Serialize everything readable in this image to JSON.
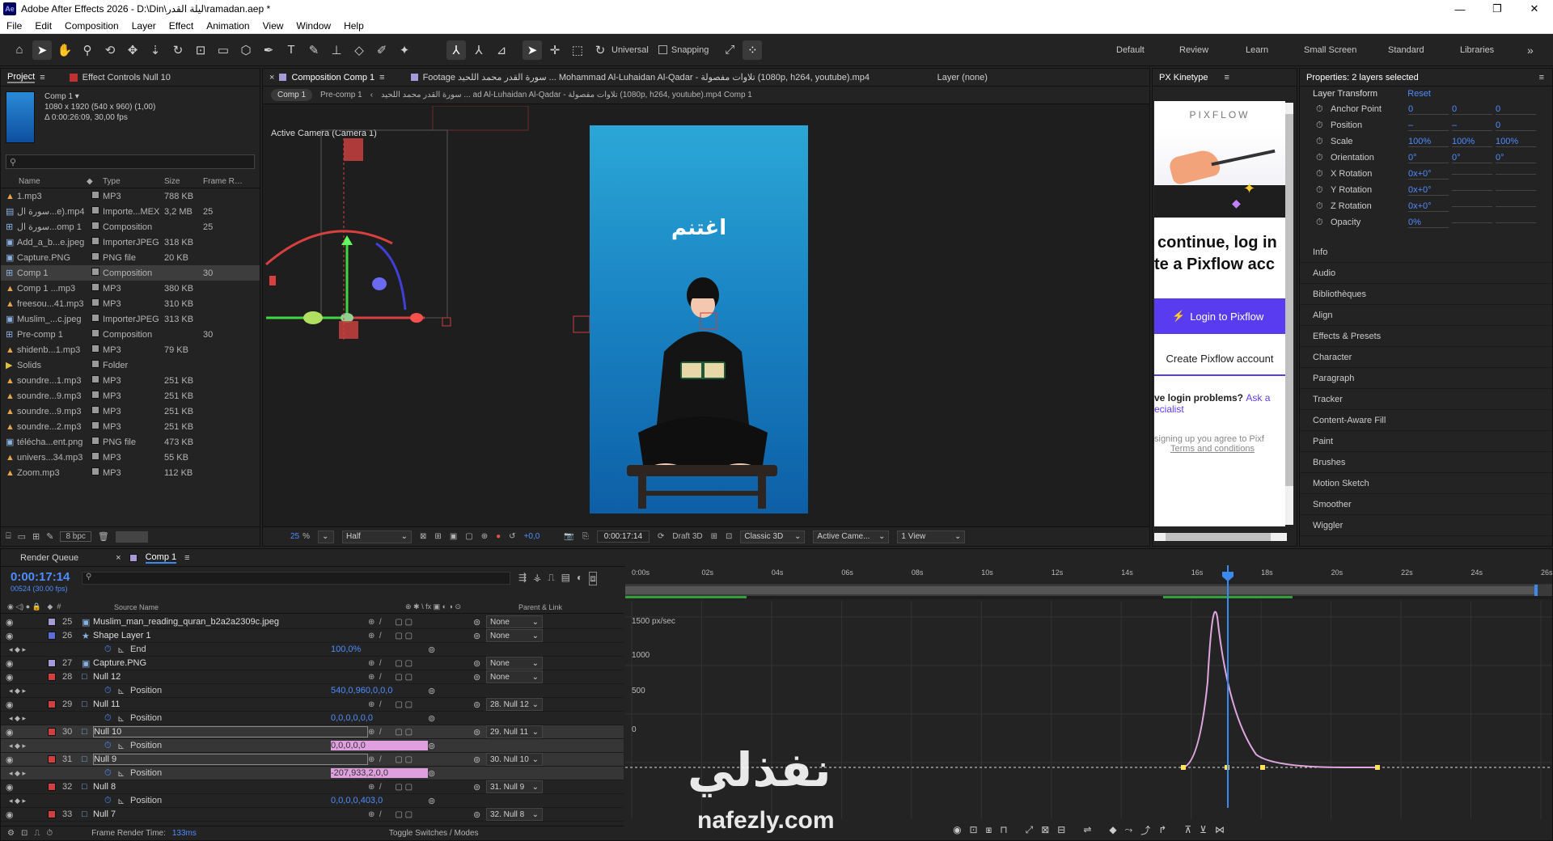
{
  "titlebar": {
    "title": "Adobe After Effects 2026 - D:\\Din\\ليلة القدر\\ramadan.aep *",
    "app_icon": "Ae",
    "minimize": "—",
    "maximize": "❐",
    "close": "✕"
  },
  "menu": [
    "File",
    "Edit",
    "Composition",
    "Layer",
    "Effect",
    "Animation",
    "View",
    "Window",
    "Help"
  ],
  "toolbar": {
    "universal": "Universal",
    "snapping": "Snapping",
    "workspaces": [
      "Default",
      "Review",
      "Learn",
      "Small Screen",
      "Standard",
      "Libraries"
    ],
    "more": "»"
  },
  "project": {
    "tab_project": "Project",
    "tab_effect": "Effect Controls Null 10",
    "comp_name": "Comp 1 ▾",
    "comp_info1": "1080 x 1920  (540 x 960) (1,00)",
    "comp_info2": "Δ 0:00:26:09, 30,00 fps",
    "search_placeholder": "",
    "headers": {
      "name": "Name",
      "type": "Type",
      "size": "Size",
      "frame": "Frame Ra..."
    },
    "items": [
      {
        "name": "1.mp3",
        "type": "MP3",
        "size": "788 KB",
        "fr": "",
        "icon": "cone",
        "color": "#c8c8c8"
      },
      {
        "name": "سورة ال...e).mp4",
        "type": "Importe...MEX",
        "size": "3,2 MB",
        "fr": "25",
        "icon": "film",
        "color": "#c8c8c8"
      },
      {
        "name": "سورة ال...omp 1",
        "type": "Composition",
        "size": "",
        "fr": "25",
        "icon": "comp",
        "color": "#c8c8c8"
      },
      {
        "name": "Add_a_b...e.jpeg",
        "type": "ImporterJPEG",
        "size": "318 KB",
        "fr": "",
        "icon": "img",
        "color": "#c8c8c8"
      },
      {
        "name": "Capture.PNG",
        "type": "PNG file",
        "size": "20 KB",
        "fr": "",
        "icon": "img",
        "color": "#c8c8c8"
      },
      {
        "name": "Comp 1",
        "type": "Composition",
        "size": "",
        "fr": "30",
        "icon": "comp",
        "color": "#c8c8c8",
        "selected": true
      },
      {
        "name": "Comp 1 ...mp3",
        "type": "MP3",
        "size": "380 KB",
        "fr": "",
        "icon": "cone",
        "color": "#c8c8c8"
      },
      {
        "name": "freesou...41.mp3",
        "type": "MP3",
        "size": "310 KB",
        "fr": "",
        "icon": "cone",
        "color": "#c8c8c8"
      },
      {
        "name": "Muslim_...c.jpeg",
        "type": "ImporterJPEG",
        "size": "313 KB",
        "fr": "",
        "icon": "img",
        "color": "#c8c8c8"
      },
      {
        "name": "Pre-comp 1",
        "type": "Composition",
        "size": "",
        "fr": "30",
        "icon": "comp",
        "color": "#c8c8c8"
      },
      {
        "name": "shidenb...1.mp3",
        "type": "MP3",
        "size": "79 KB",
        "fr": "",
        "icon": "cone",
        "color": "#c8c8c8"
      },
      {
        "name": "Solids",
        "type": "Folder",
        "size": "",
        "fr": "",
        "icon": "folder",
        "color": "#e0c040"
      },
      {
        "name": "soundre...1.mp3",
        "type": "MP3",
        "size": "251 KB",
        "fr": "",
        "icon": "cone",
        "color": "#c8c8c8"
      },
      {
        "name": "soundre...9.mp3",
        "type": "MP3",
        "size": "251 KB",
        "fr": "",
        "icon": "cone",
        "color": "#c8c8c8"
      },
      {
        "name": "soundre...9.mp3",
        "type": "MP3",
        "size": "251 KB",
        "fr": "",
        "icon": "cone",
        "color": "#c8c8c8"
      },
      {
        "name": "soundre...2.mp3",
        "type": "MP3",
        "size": "251 KB",
        "fr": "",
        "icon": "cone",
        "color": "#c8c8c8"
      },
      {
        "name": "télécha...ent.png",
        "type": "PNG file",
        "size": "473 KB",
        "fr": "",
        "icon": "img",
        "color": "#c8c8c8"
      },
      {
        "name": "univers...34.mp3",
        "type": "MP3",
        "size": "55 KB",
        "fr": "",
        "icon": "cone",
        "color": "#c8c8c8"
      },
      {
        "name": "Zoom.mp3",
        "type": "MP3",
        "size": "112 KB",
        "fr": "",
        "icon": "cone",
        "color": "#c8c8c8"
      }
    ],
    "bpc": "8 bpc"
  },
  "viewer": {
    "tab_comp": "Composition Comp 1",
    "tab_footage": "Footage سورة القدر محمد اللحيد ... Mohammad Al-Luhaidan Al-Qadar - تلاوات مفصولة (1080p, h264, youtube).mp4",
    "tab_layer": "Layer (none)",
    "crumb1": "Comp 1",
    "crumb2": "Pre-comp 1",
    "crumb3": "سورة القدر محمد اللحيد ... ad Al-Luhaidan Al-Qadar - تلاوات مفصولة (1080p, h264, youtube).mp4 Comp 1",
    "camera_label": "Active Camera (Camera 1)",
    "arabic_text": "اغتنم",
    "zoom": "25",
    "zoom_unit": "%",
    "resolution": "Half",
    "exposure": "+0,0",
    "timecode": "0:00:17:14",
    "draft": "Draft 3D",
    "renderer": "Classic 3D",
    "camera": "Active Came...",
    "views": "1 View"
  },
  "pixflow": {
    "tab": "PX Kinetype",
    "logo": "PIXFLOW",
    "line1": "continue, log in",
    "line2": "te a Pixflow acc",
    "login_btn": "Login to Pixflow",
    "create_btn": "Create Pixflow account",
    "problems": "ve login problems?",
    "ask": "Ask a",
    "specialist": "ecialist",
    "terms1": "signing up you agree to Pixf",
    "terms2": "Terms and conditions"
  },
  "properties": {
    "tab": "Properties: 2 layers selected",
    "section": "Layer Transform",
    "reset": "Reset",
    "rows": [
      {
        "label": "Anchor Point",
        "v1": "0",
        "v2": "0",
        "v3": "0"
      },
      {
        "label": "Position",
        "v1": "–",
        "v2": "–",
        "v3": "0"
      },
      {
        "label": "Scale",
        "v1": "100%",
        "v2": "100%",
        "v3": "100%"
      },
      {
        "label": "Orientation",
        "v1": "0°",
        "v2": "0°",
        "v3": "0°"
      },
      {
        "label": "X Rotation",
        "v1": "0x+0°",
        "v2": "",
        "v3": ""
      },
      {
        "label": "Y Rotation",
        "v1": "0x+0°",
        "v2": "",
        "v3": ""
      },
      {
        "label": "Z Rotation",
        "v1": "0x+0°",
        "v2": "",
        "v3": ""
      },
      {
        "label": "Opacity",
        "v1": "0%",
        "v2": "",
        "v3": ""
      }
    ],
    "panels": [
      "Info",
      "Audio",
      "Bibliothèques",
      "Align",
      "Effects & Presets",
      "Character",
      "Paragraph",
      "Tracker",
      "Content-Aware Fill",
      "Paint",
      "Brushes",
      "Motion Sketch",
      "Smoother",
      "Wiggler"
    ]
  },
  "timeline": {
    "tab_render": "Render Queue",
    "tab_comp": "Comp 1",
    "timecode": "0:00:17:14",
    "frame_info": "00524 (30.00 fps)",
    "col_source": "Source Name",
    "col_parent": "Parent & Link",
    "layers": [
      {
        "num": "25",
        "name": "Muslim_man_reading_quran_b2a2a2309c.jpeg",
        "color": "#a89ad8",
        "parent": "None",
        "kind": "layer",
        "icon": "img"
      },
      {
        "num": "26",
        "name": "Shape Layer 1",
        "color": "#5a6ed8",
        "parent": "None",
        "kind": "layer",
        "icon": "star"
      },
      {
        "num": "",
        "name": "End",
        "value": "100,0%",
        "kind": "prop"
      },
      {
        "num": "27",
        "name": "Capture.PNG",
        "color": "#a89ad8",
        "parent": "None",
        "kind": "layer",
        "icon": "img"
      },
      {
        "num": "28",
        "name": "Null 12",
        "color": "#d04040",
        "parent": "None",
        "kind": "layer",
        "icon": "null"
      },
      {
        "num": "",
        "name": "Position",
        "value": "540,0,960,0,0,0",
        "kind": "prop"
      },
      {
        "num": "29",
        "name": "Null 11",
        "color": "#d04040",
        "parent": "28. Null 12",
        "kind": "layer",
        "icon": "null"
      },
      {
        "num": "",
        "name": "Position",
        "value": "0,0,0,0,0,0",
        "kind": "prop"
      },
      {
        "num": "30",
        "name": "Null 10",
        "color": "#d04040",
        "parent": "29. Null 11",
        "kind": "layer",
        "icon": "null",
        "selected": true
      },
      {
        "num": "",
        "name": "Position",
        "value": "0,0,0,0,0",
        "kind": "prop",
        "selected": true,
        "hl": true
      },
      {
        "num": "31",
        "name": "Null 9",
        "color": "#d04040",
        "parent": "30. Null 10",
        "kind": "layer",
        "icon": "null",
        "selected": true
      },
      {
        "num": "",
        "name": "Position",
        "value": "-207,933,2,0,0",
        "kind": "prop",
        "selected": true,
        "hl": true
      },
      {
        "num": "32",
        "name": "Null 8",
        "color": "#d04040",
        "parent": "31. Null 9",
        "kind": "layer",
        "icon": "null"
      },
      {
        "num": "",
        "name": "Position",
        "value": "0,0,0,0,403,0",
        "kind": "prop"
      },
      {
        "num": "33",
        "name": "Null 7",
        "color": "#d04040",
        "parent": "32. Null 8",
        "kind": "layer",
        "icon": "null"
      }
    ],
    "ruler": [
      "0:00s",
      "02s",
      "04s",
      "06s",
      "08s",
      "10s",
      "12s",
      "14s",
      "16s",
      "18s",
      "20s",
      "22s",
      "24s",
      "26s"
    ],
    "graph_labels": [
      "1500 px/sec",
      "1000",
      "500",
      "0"
    ],
    "render_time_label": "Frame Render Time:",
    "render_time": "133ms",
    "toggle": "Toggle Switches / Modes"
  },
  "watermark": {
    "arabic": "نفذلي",
    "latin": "nafezly.com"
  }
}
